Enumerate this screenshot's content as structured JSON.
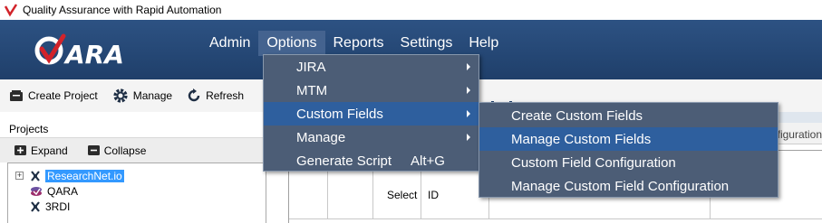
{
  "window": {
    "title": "Quality Assurance with Rapid Automation"
  },
  "logo": {
    "text": "QARA"
  },
  "menubar": {
    "items": [
      {
        "label": "Admin"
      },
      {
        "label": "Options"
      },
      {
        "label": "Reports"
      },
      {
        "label": "Settings"
      },
      {
        "label": "Help"
      }
    ],
    "active": "Options"
  },
  "toolbar": {
    "create_project": "Create Project",
    "manage": "Manage",
    "refresh": "Refresh"
  },
  "projects": {
    "label": "Projects",
    "expand": "Expand",
    "collapse": "Collapse",
    "items": [
      {
        "label": "ResearchNet.io",
        "selected": true
      },
      {
        "label": "QARA"
      },
      {
        "label": "3RDI"
      }
    ]
  },
  "content": {
    "header_cutoff_text": "nfiguration",
    "columns": [
      "Select",
      "ID"
    ]
  },
  "options_menu": {
    "items": [
      {
        "label": "JIRA",
        "has_submenu": true
      },
      {
        "label": "MTM",
        "has_submenu": true
      },
      {
        "label": "Custom Fields",
        "has_submenu": true
      },
      {
        "label": "Manage",
        "has_submenu": true
      },
      {
        "label": "Generate Script",
        "shortcut": "Alt+G"
      }
    ]
  },
  "custom_fields_submenu": {
    "items": [
      {
        "label": "Create Custom Fields"
      },
      {
        "label": "Manage Custom Fields"
      },
      {
        "label": "Custom Field Configuration"
      },
      {
        "label": "Manage Custom Field Configuration"
      }
    ]
  },
  "colors": {
    "header_bg": "#1f3f6a",
    "menu_bg": "#4c5d76",
    "menu_hover": "#2e5f9e",
    "selection": "#3399ff",
    "logo_accent": "#d2232a"
  }
}
